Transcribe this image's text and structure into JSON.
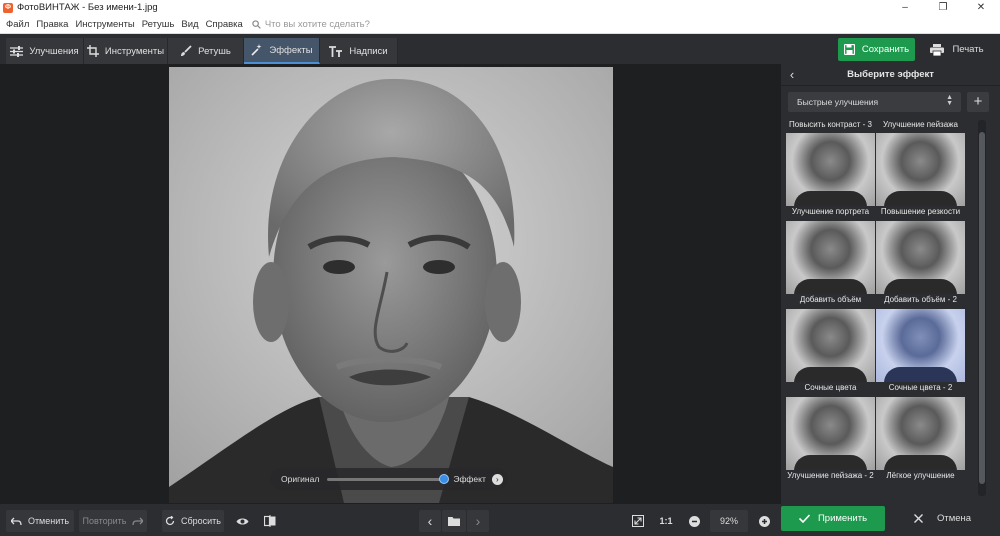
{
  "window": {
    "title": "ФотоВИНТАЖ - Без имени-1.jpg",
    "app_icon": "app-logo-icon",
    "minimize": "–",
    "maximize": "❐",
    "close": "✕"
  },
  "menu": {
    "items": [
      "Файл",
      "Правка",
      "Инструменты",
      "Ретушь",
      "Вид",
      "Справка"
    ],
    "search_placeholder": "Что вы хотите сделать?"
  },
  "tabs": [
    {
      "label": "Улучшения",
      "icon": "sliders-icon"
    },
    {
      "label": "Инструменты",
      "icon": "crop-icon"
    },
    {
      "label": "Ретушь",
      "icon": "brush-icon"
    },
    {
      "label": "Эффекты",
      "icon": "magic-wand-icon",
      "active": true
    },
    {
      "label": "Надписи",
      "icon": "text-icon"
    }
  ],
  "actions": {
    "save": "Сохранить",
    "print": "Печать"
  },
  "compare": {
    "original": "Оригинал",
    "effect": "Эффект",
    "level": 1.0
  },
  "panel": {
    "title": "Выберите эффект",
    "dropdown_value": "Быстрые улучшения",
    "effects": [
      {
        "label": "Повысить контраст - 3",
        "tint": "gray"
      },
      {
        "label": "Улучшение пейзажа",
        "tint": "gray"
      },
      {
        "label": "Улучшение портрета",
        "tint": "gray"
      },
      {
        "label": "Повышение резкости",
        "tint": "gray"
      },
      {
        "label": "Добавить объём",
        "tint": "gray"
      },
      {
        "label": "Добавить объём - 2",
        "tint": "gray"
      },
      {
        "label": "Сочные цвета",
        "tint": "gray"
      },
      {
        "label": "Сочные цвета - 2",
        "tint": "blue"
      },
      {
        "label": "Улучшение пейзажа - 2",
        "tint": "gray"
      },
      {
        "label": "Лёгкое улучшение",
        "tint": "gray"
      }
    ]
  },
  "bottom": {
    "undo": "Отменить",
    "redo": "Повторить",
    "reset": "Сбросить",
    "one_to_one": "1:1",
    "zoom": "92%",
    "apply": "Применить",
    "cancel": "Отмена"
  },
  "colors": {
    "accent_green": "#1e9a4e",
    "active_tab": "#46566a",
    "blue_accent": "#3a8ee6"
  }
}
